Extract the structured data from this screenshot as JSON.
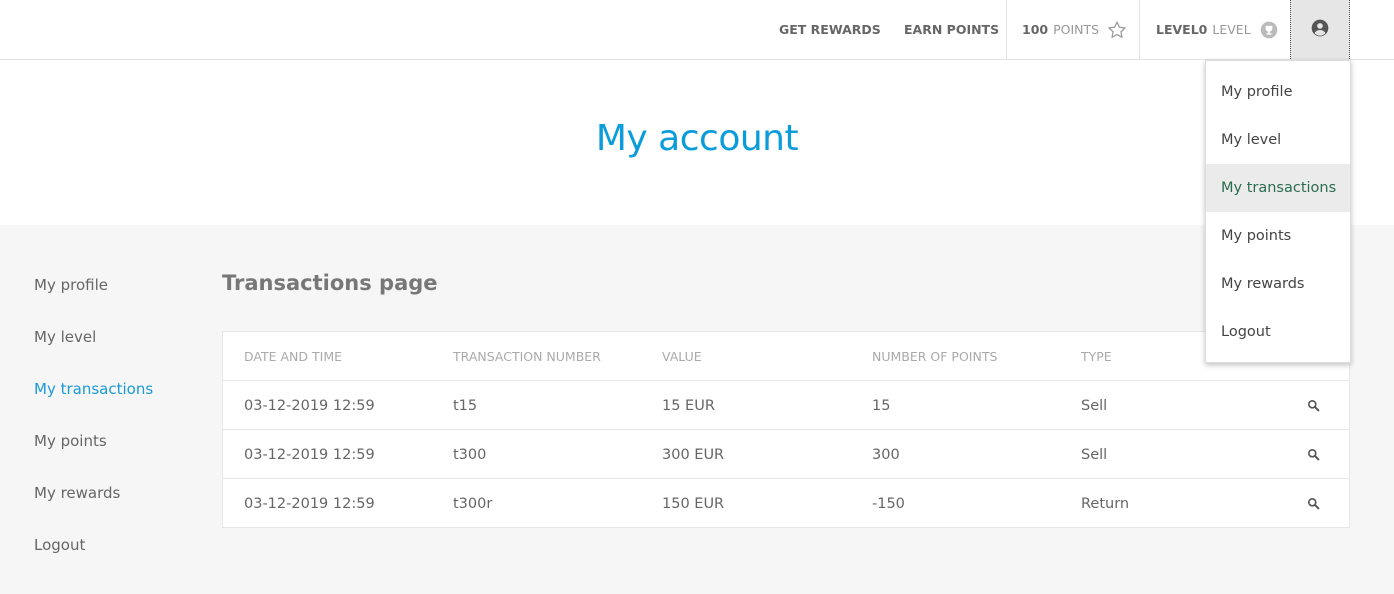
{
  "topnav": {
    "get_rewards": "GET REWARDS",
    "earn_points": "EARN POINTS",
    "points_value": "100",
    "points_label": "POINTS",
    "level_value": "LEVEL0",
    "level_label": "LEVEL"
  },
  "hero": {
    "title": "My account"
  },
  "sidebar": {
    "items": [
      {
        "label": "My profile"
      },
      {
        "label": "My level"
      },
      {
        "label": "My transactions"
      },
      {
        "label": "My points"
      },
      {
        "label": "My rewards"
      },
      {
        "label": "Logout"
      }
    ],
    "active": "My transactions"
  },
  "main": {
    "title": "Transactions page",
    "table": {
      "headers": [
        "DATE AND TIME",
        "TRANSACTION NUMBER",
        "VALUE",
        "NUMBER OF POINTS",
        "TYPE"
      ],
      "rows": [
        [
          "03-12-2019 12:59",
          "t15",
          "15 EUR",
          "15",
          "Sell"
        ],
        [
          "03-12-2019 12:59",
          "t300",
          "300 EUR",
          "300",
          "Sell"
        ],
        [
          "03-12-2019 12:59",
          "t300r",
          "150 EUR",
          "-150",
          "Return"
        ]
      ]
    }
  },
  "user_menu": {
    "items": [
      {
        "label": "My profile"
      },
      {
        "label": "My level"
      },
      {
        "label": "My transactions"
      },
      {
        "label": "My points"
      },
      {
        "label": "My rewards"
      },
      {
        "label": "Logout"
      }
    ],
    "active": "My transactions"
  },
  "icons": {
    "points": "star-icon",
    "level": "trophy-icon",
    "user": "user-circle-icon",
    "row_action": "search-icon"
  },
  "colors": {
    "accent": "#0b9ddb",
    "active_link": "#1a9ad6",
    "menu_active_text": "#2b6d4f"
  }
}
